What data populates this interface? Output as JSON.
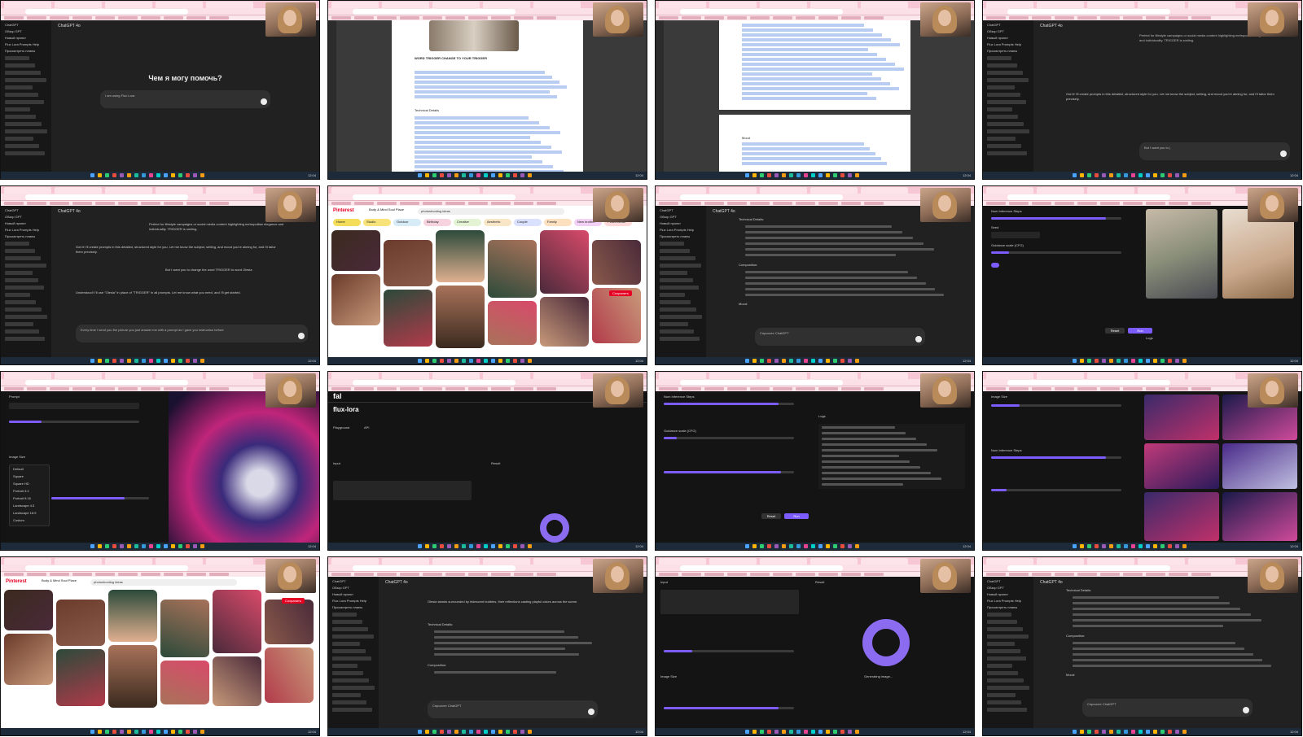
{
  "screen": {
    "title": "Screen recording collage"
  },
  "chatgpt": {
    "model_label": "ChatGPT 4o",
    "welcome": "Чем я могу помочь?",
    "input_placeholder": "I am using Flux Lora",
    "input_placeholder_2": "But I want you to |",
    "input_placeholder_3": "Every time I send you the picture you just answer me with a prompt as I gave you instruction before",
    "input_placeholder_ru": "Спросите ChatGPT",
    "sidebar_items": [
      "ChatGPT",
      "Обзор GPT",
      "Новый проект",
      "Flux Lora Prompts Help",
      "Просмотреть планы"
    ],
    "msg_prompt_trigger": "Perfect for lifestyle campaigns or social media content highlighting metropolitan elegance and individuality. TRIGGER is smiling.",
    "msg_ready": "Got it! I'll create prompts in this detailed, structured style for you. Let me know the subject, setting, and mood you're aiming for, and I'll tailor them precisely.",
    "msg_change": "But I want you to change the word TRIGGER to word Olesia",
    "msg_updated": "Understood! I'll use \"Olesia\" in place of \"TRIGGER\" in all prompts. Let me know what you need, and I'll get started.",
    "msg_olesia": "Olesia stands surrounded by iridescent bubbles, their reflections casting playful colors across the scene.",
    "tech_details": "Technical Details:",
    "composition": "Composition:",
    "mood": "Mood:"
  },
  "document": {
    "heading": "WORD TRIGGER CHANGE TO YOUR TRIGGER",
    "para": "TRIGGER leans gracefully against the wooden rails of the Brooklyn Bridge, her posture radiating calm confidence.",
    "tech": "Technical Details",
    "camera": "Camera: Sony Alpha 7R IV for capturing fine details and dynamic range.",
    "lens": "Lens: 35mm f/1.4 for a balanced view of the subject and background.",
    "lighting": "Lighting: Soft natural light on an overcast day, providing even exposure and subtle warmth.",
    "settings": "Settings: Aperture f/2.8, ISO 200, shutter speed 1/250 for crisp focus and slight background blur.",
    "mood": "Mood"
  },
  "pinterest": {
    "brand": "Pinterest",
    "board": "Body & Mind Soul Place",
    "search": "photoshooting ideas",
    "save_label": "Сохранить",
    "chips": [
      "Home",
      "Studio",
      "Outdoor",
      "Birthday",
      "Creative",
      "Aesthetic",
      "Couple",
      "Family",
      "New brother",
      "Poses ideas"
    ]
  },
  "fal": {
    "brand": "fal",
    "model": "flux-lora",
    "tab_playground": "Playground",
    "tab_api": "API",
    "input_label": "Input",
    "result_label": "Result",
    "prompt_label": "Prompt",
    "image_size_label": "Image Size",
    "image_size_value": "Portrait 3:4",
    "steps_label": "Num Inference Steps",
    "seed_label": "Seed",
    "guidance_label": "Guidance scale (CFG)",
    "logs_label": "Logs",
    "run_label": "Run",
    "reset_label": "Reset",
    "generating": "Generating image...",
    "size_options": [
      "Default",
      "Square",
      "Square HD",
      "Portrait 3:4",
      "Portrait 9:16",
      "Landscape 4:3",
      "Landscape 16:9",
      "Custom"
    ]
  },
  "taskbar": {
    "clock": "12:04"
  },
  "colors": {
    "accent": "#7c5cff",
    "browser_tabbar": "#f7c8d3",
    "dark": "#212121"
  }
}
